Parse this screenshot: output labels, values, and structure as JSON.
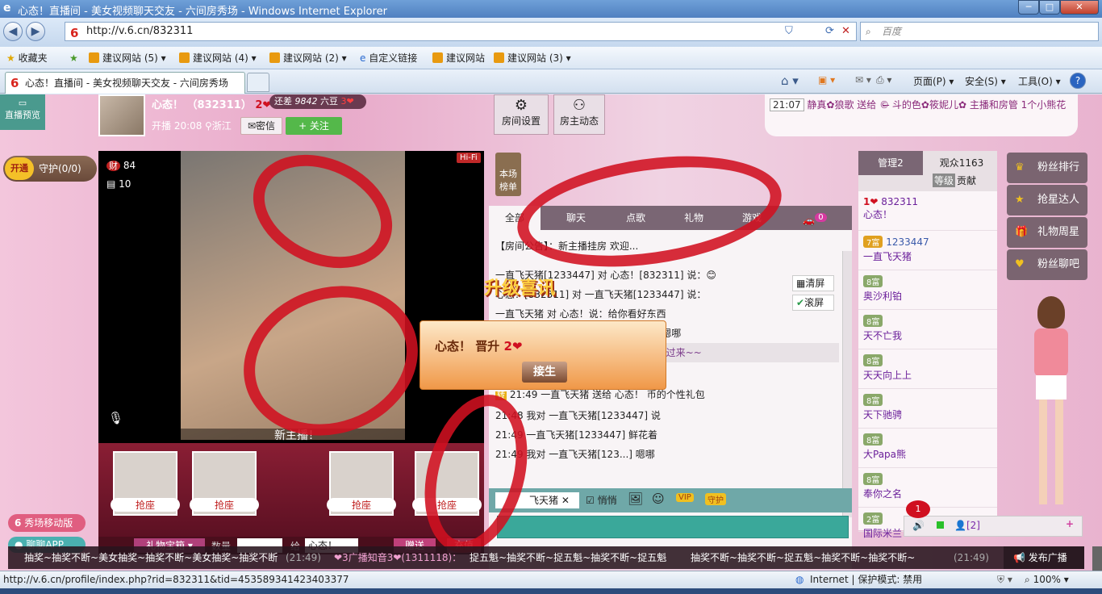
{
  "window": {
    "title": "心态！直播间 - 美女视频聊天交友 - 六间房秀场 - Windows Internet Explorer",
    "minimize": "─",
    "maximize": "□",
    "close": "✕"
  },
  "address": {
    "url": "http://v.6.cn/832311",
    "search_placeholder": "百度"
  },
  "favbar": {
    "favorites": "收藏夹",
    "items": [
      "建议网站 (5)",
      "建议网站 (4)",
      "建议网站 (2)",
      "自定义链接",
      "建议网站",
      "建议网站 (3)"
    ]
  },
  "tab": {
    "title": "心态！直播间 - 美女视频聊天交友 - 六间房秀场"
  },
  "commandbar": {
    "page": "页面(P)",
    "safety": "安全(S)",
    "tools": "工具(O)",
    "help": "?"
  },
  "left": {
    "preview": "直播预览",
    "open": "开通",
    "guard": "守护(0/0)",
    "mobile": "秀场移动版",
    "app": "聊聊APP"
  },
  "host": {
    "name": "心态！",
    "id": "（832311）",
    "level": "2",
    "gap_label": "还差",
    "gap_value": "9842",
    "gap_unit": "六豆",
    "next_level": "3",
    "start": "开播 20:08",
    "location": "浙江",
    "msg": "密信",
    "follow": "+ 关注"
  },
  "host_tools": {
    "settings": "房间设置",
    "news": "房主动态"
  },
  "notice": {
    "time": "21:07",
    "text": "静真✿狼歌 送给 ©̶ 斗的色✿筱妮儿✿ 主播和房管 1个小熊花"
  },
  "video": {
    "wealth_count": "84",
    "gift_count": "10",
    "hifi": "Hi-Fi",
    "banner": "新主播！",
    "rank": "本场榜单"
  },
  "seats": [
    "抢座",
    "抢座",
    "抢座",
    "抢座"
  ],
  "chat_tabs": {
    "all": "全部",
    "chat": "聊天",
    "order": "点歌",
    "gift": "礼物",
    "game": "游戏",
    "car_badge": "0"
  },
  "chat_tools": {
    "clear": "清屏",
    "scroll": "滚屏"
  },
  "chat_lines": [
    {
      "text": "【房间公告】：新主播挂房 欢迎..."
    },
    {
      "text": "一直飞天猪[1233447] 对 心态！[832311] 说：😊"
    },
    {
      "text": "心态！[832311] 对 一直飞天猪[1233447] 说："
    },
    {
      "text": "一直飞天猪 对 心态！说：给你看好东西"
    },
    {
      "text": "一直飞天猪 对 心态！[1233447] 说：嗯哪"
    },
    {
      "text": "系统消息：欢迎 一直飞天猪 进入直播间过来~~"
    }
  ],
  "chat_lines2": [
    {
      "time": "21:49",
      "text": "一直飞天猪 送给 心态！ 币的个性礼包"
    },
    {
      "time": "21:48",
      "text": "我对 一直飞天猪[1233447] 说"
    },
    {
      "time": "21:49",
      "text": "一直飞天猪[1233447] 鲜花着"
    },
    {
      "time": "21:49",
      "text": "我对 一直飞天猪[123...] 嗯哪"
    }
  ],
  "chat_input": {
    "target": "飞天猪",
    "quiet": "悄悄",
    "vip": "VIP",
    "guard": "守护"
  },
  "popup": {
    "title": "升级喜讯",
    "text": "心态！  晋升",
    "level": "2",
    "button": "接生"
  },
  "gift_bar": {
    "gift": "礼物宝箱",
    "count_label": "数量",
    "to": "给",
    "to_value": "心态！",
    "send": "赠送",
    "recharge": "充值"
  },
  "users": {
    "tab_admin": "管理2",
    "tab_viewers": "观众1163",
    "sort_level": "等级",
    "sort_contrib": "贡献",
    "list": [
      {
        "level": "1",
        "name": "832311",
        "sub": "心态！"
      },
      {
        "level": "7富",
        "name": "1233447",
        "sub": "一直飞天猪"
      },
      {
        "level": "8富",
        "name": "奥沙利铂",
        "sub": ""
      },
      {
        "level": "8富",
        "name": "天不亡我",
        "sub": ""
      },
      {
        "level": "8富",
        "name": "天天向上上",
        "sub": ""
      },
      {
        "level": "8富",
        "name": "天下驰骋",
        "sub": ""
      },
      {
        "level": "8富",
        "name": "大Papa熊",
        "sub": ""
      },
      {
        "level": "8富",
        "name": "奉你之名",
        "sub": ""
      },
      {
        "level": "2富",
        "name": "国际米兰",
        "sub": ""
      }
    ]
  },
  "right_menu": [
    "粉丝排行",
    "抢星达人",
    "礼物周星",
    "粉丝聊吧"
  ],
  "bottom_bar": {
    "badge": "1",
    "count": "[2]"
  },
  "ticker": {
    "text1": "抽奖~抽奖不断~美女抽奖~抽奖不断~美女抽奖~抽奖不断",
    "time1": "(21:49)",
    "source": "❤3广播知音3❤(1311118)：",
    "text2": "捉五魁~抽奖不断~捉五魁~抽奖不断~捉五魁",
    "text3": "抽奖不断~抽奖不断~捉五魁~抽奖不断~抽奖不断~",
    "time2": "(21:49)",
    "broadcast": "发布广播"
  },
  "status": {
    "url": "http://v.6.cn/profile/index.php?rid=832311&tid=453589341423403377",
    "zone": "Internet | 保护模式: 禁用",
    "zoom": "100%"
  },
  "colors": {
    "accent": "#d8251d",
    "rose": "#d01020",
    "ie_blue": "#4f80c0"
  }
}
